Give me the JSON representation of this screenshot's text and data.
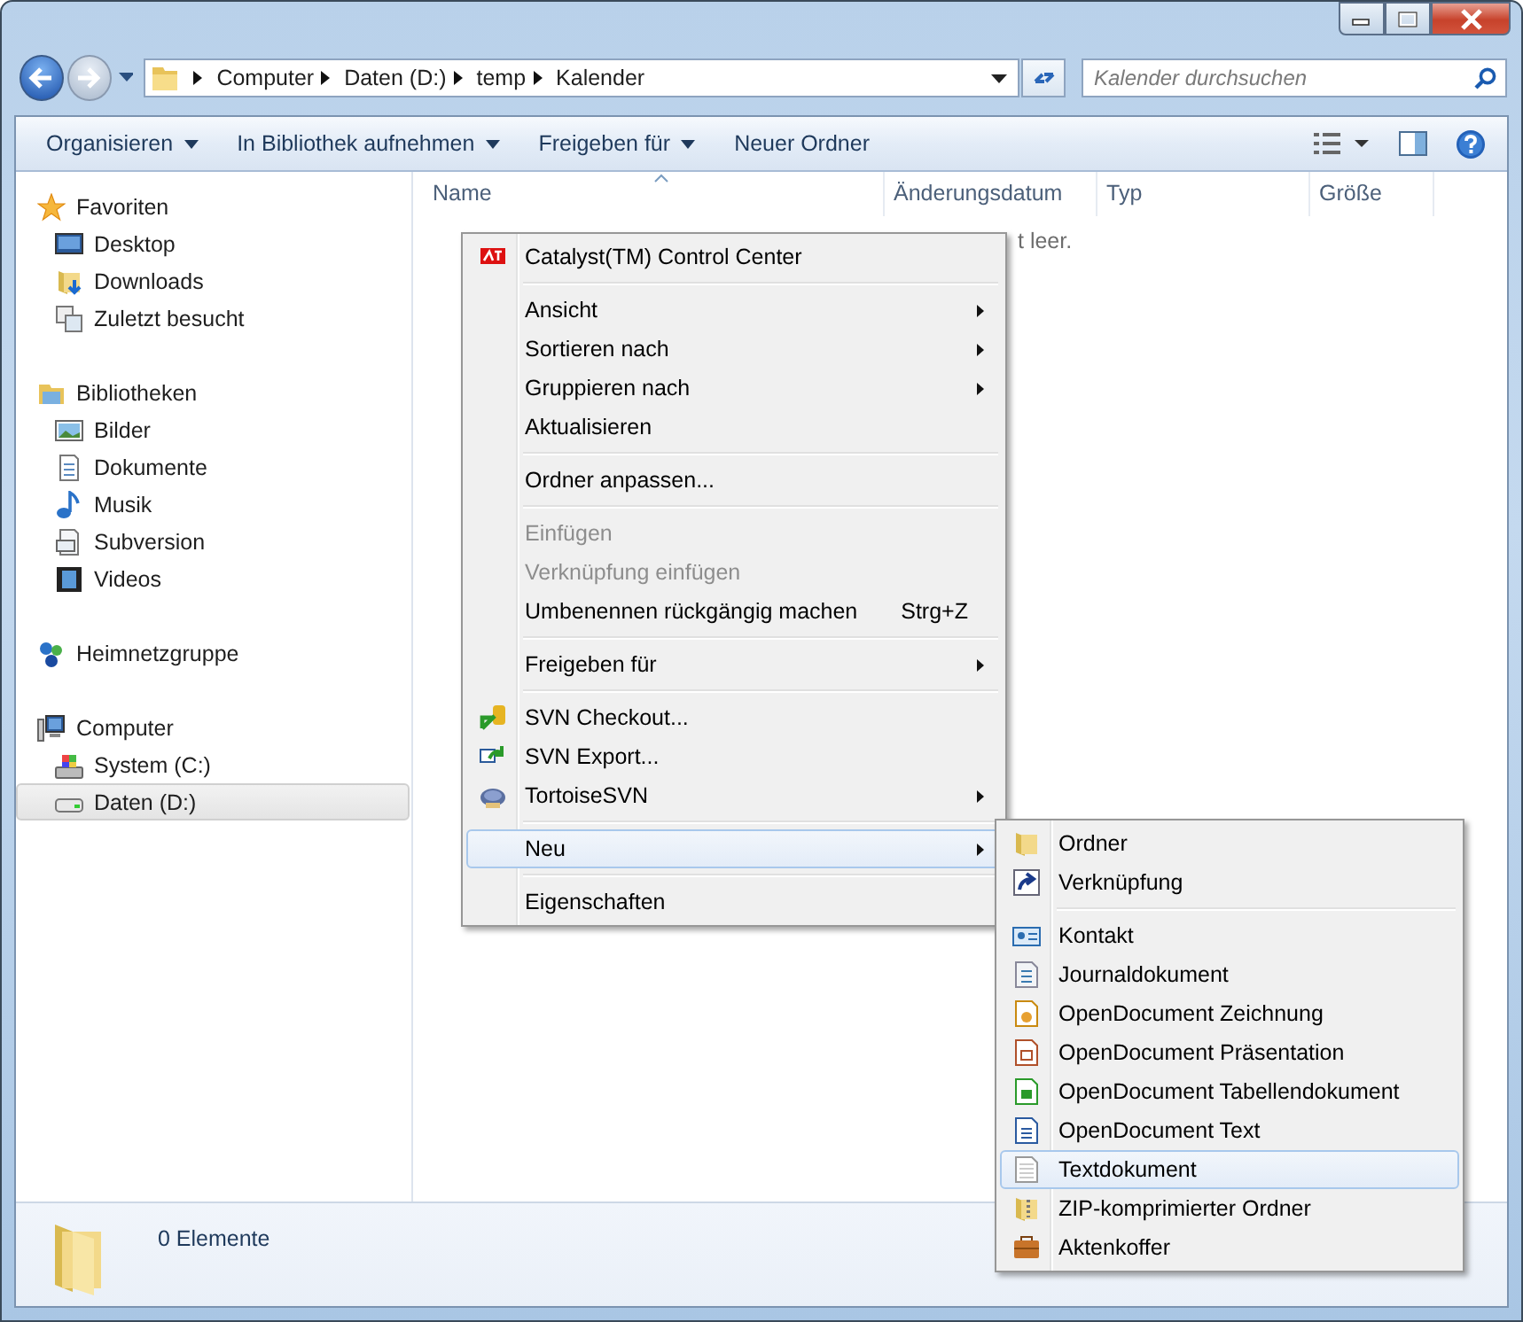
{
  "address_bar": {
    "breadcrumbs": [
      "Computer",
      "Daten (D:)",
      "temp",
      "Kalender"
    ]
  },
  "search": {
    "placeholder": "Kalender durchsuchen"
  },
  "toolbar": {
    "buttons": [
      {
        "label": "Organisieren",
        "dropdown": true
      },
      {
        "label": "In Bibliothek aufnehmen",
        "dropdown": true
      },
      {
        "label": "Freigeben für",
        "dropdown": true
      },
      {
        "label": "Neuer Ordner",
        "dropdown": false
      }
    ]
  },
  "sidebar": {
    "groups": [
      {
        "label": "Favoriten",
        "selected": false,
        "children": [
          {
            "label": "Desktop",
            "selected": false
          },
          {
            "label": "Downloads",
            "selected": false
          },
          {
            "label": "Zuletzt besucht",
            "selected": false
          }
        ]
      },
      {
        "label": "Bibliotheken",
        "selected": false,
        "children": [
          {
            "label": "Bilder",
            "selected": false
          },
          {
            "label": "Dokumente",
            "selected": false
          },
          {
            "label": "Musik",
            "selected": false
          },
          {
            "label": "Subversion",
            "selected": false
          },
          {
            "label": "Videos",
            "selected": false
          }
        ]
      },
      {
        "label": "Heimnetzgruppe",
        "selected": false
      },
      {
        "label": "Computer",
        "selected": false,
        "children": [
          {
            "label": "System (C:)",
            "selected": false
          },
          {
            "label": "Daten (D:)",
            "selected": true
          }
        ]
      }
    ]
  },
  "file_list": {
    "columns": [
      "Name",
      "Änderungsdatum",
      "Typ",
      "Größe"
    ],
    "empty_message": "t leer."
  },
  "context_menu": {
    "items": [
      {
        "kind": "item",
        "label": "Catalyst(TM) Control Center",
        "submenu": false,
        "disabled": false,
        "selected": false
      },
      {
        "kind": "separator"
      },
      {
        "kind": "item",
        "label": "Ansicht",
        "submenu": true,
        "disabled": false,
        "selected": false
      },
      {
        "kind": "item",
        "label": "Sortieren nach",
        "submenu": true,
        "disabled": false,
        "selected": false
      },
      {
        "kind": "item",
        "label": "Gruppieren nach",
        "submenu": true,
        "disabled": false,
        "selected": false
      },
      {
        "kind": "item",
        "label": "Aktualisieren",
        "submenu": false,
        "disabled": false,
        "selected": false
      },
      {
        "kind": "separator"
      },
      {
        "kind": "item",
        "label": "Ordner anpassen...",
        "submenu": false,
        "disabled": false,
        "selected": false
      },
      {
        "kind": "separator"
      },
      {
        "kind": "item",
        "label": "Einfügen",
        "submenu": false,
        "disabled": true,
        "selected": false
      },
      {
        "kind": "item",
        "label": "Verknüpfung einfügen",
        "submenu": false,
        "disabled": true,
        "selected": false
      },
      {
        "kind": "item",
        "label": "Umbenennen rückgängig machen",
        "shortcut": "Strg+Z",
        "submenu": false,
        "disabled": false,
        "selected": false
      },
      {
        "kind": "separator"
      },
      {
        "kind": "item",
        "label": "Freigeben für",
        "submenu": true,
        "disabled": false,
        "selected": false
      },
      {
        "kind": "separator"
      },
      {
        "kind": "item",
        "label": "SVN Checkout...",
        "submenu": false,
        "disabled": false,
        "selected": false
      },
      {
        "kind": "item",
        "label": "SVN Export...",
        "submenu": false,
        "disabled": false,
        "selected": false
      },
      {
        "kind": "item",
        "label": "TortoiseSVN",
        "submenu": true,
        "disabled": false,
        "selected": false
      },
      {
        "kind": "separator"
      },
      {
        "kind": "item",
        "label": "Neu",
        "submenu": true,
        "disabled": false,
        "selected": true
      },
      {
        "kind": "separator"
      },
      {
        "kind": "item",
        "label": "Eigenschaften",
        "submenu": false,
        "disabled": false,
        "selected": false
      }
    ]
  },
  "new_submenu": {
    "items": [
      {
        "kind": "item",
        "label": "Ordner",
        "selected": false
      },
      {
        "kind": "item",
        "label": "Verknüpfung",
        "selected": false
      },
      {
        "kind": "separator"
      },
      {
        "kind": "item",
        "label": "Kontakt",
        "selected": false
      },
      {
        "kind": "item",
        "label": "Journaldokument",
        "selected": false
      },
      {
        "kind": "item",
        "label": "OpenDocument Zeichnung",
        "selected": false
      },
      {
        "kind": "item",
        "label": "OpenDocument Präsentation",
        "selected": false
      },
      {
        "kind": "item",
        "label": "OpenDocument Tabellendokument",
        "selected": false
      },
      {
        "kind": "item",
        "label": "OpenDocument Text",
        "selected": false
      },
      {
        "kind": "item",
        "label": "Textdokument",
        "selected": true
      },
      {
        "kind": "item",
        "label": "ZIP-komprimierter Ordner",
        "selected": false
      },
      {
        "kind": "item",
        "label": "Aktenkoffer",
        "selected": false
      }
    ]
  },
  "status_bar": {
    "text": "0 Elemente"
  }
}
